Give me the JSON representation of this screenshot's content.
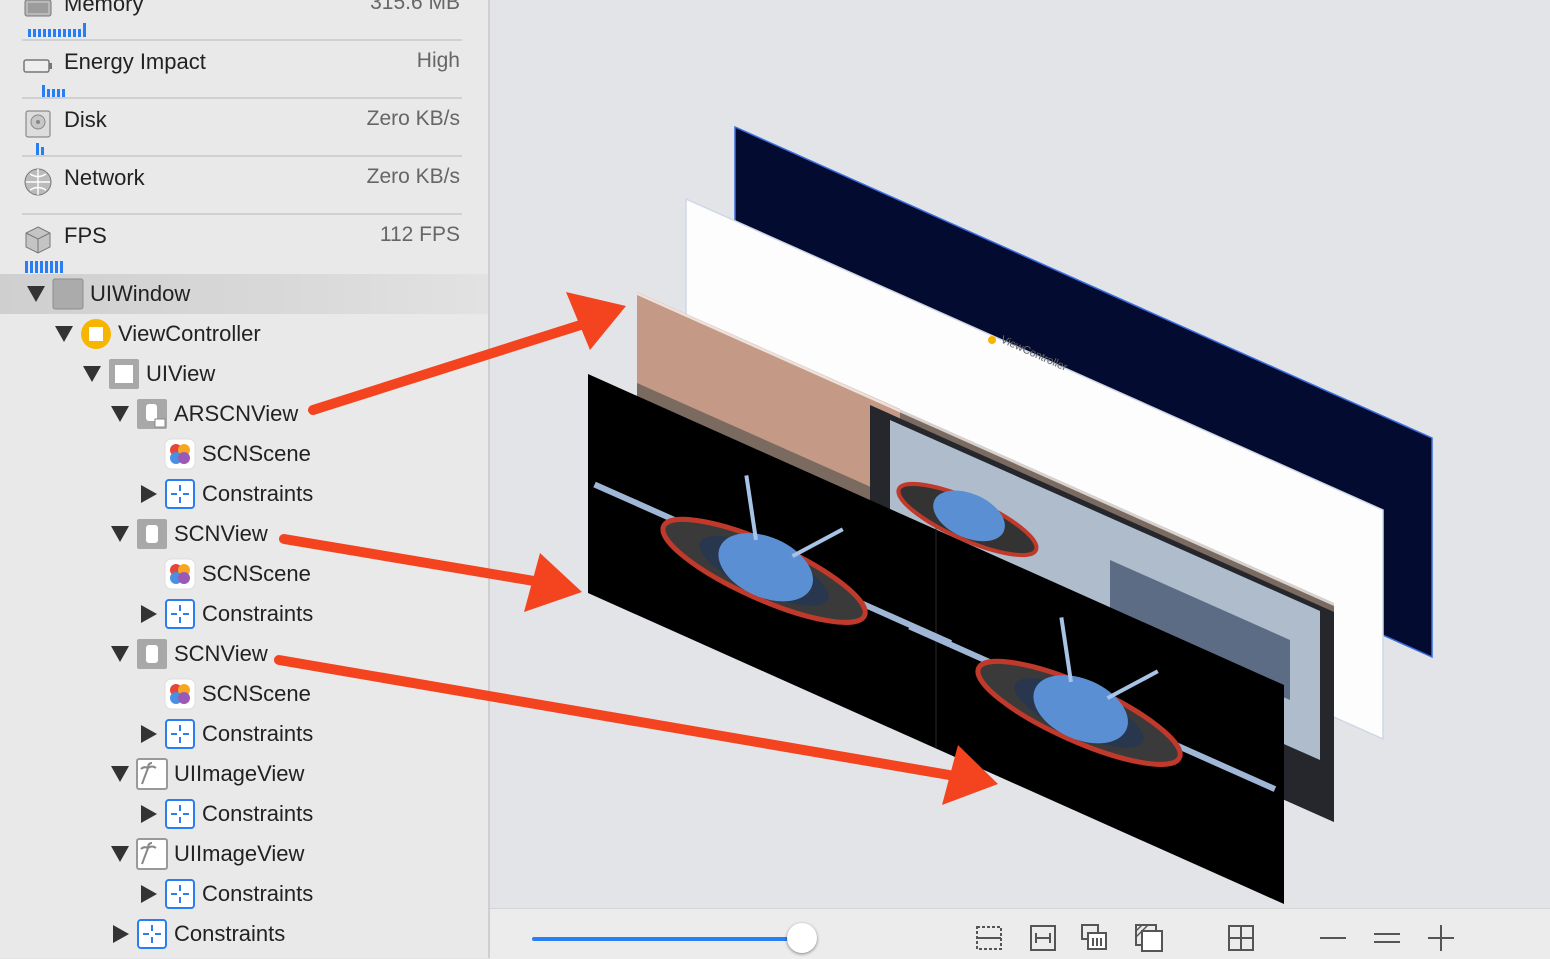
{
  "gauges": [
    {
      "label": "Memory",
      "value": "315.6 MB",
      "icon": "memory-chip-icon"
    },
    {
      "label": "Energy Impact",
      "value": "High",
      "icon": "battery-icon"
    },
    {
      "label": "Disk",
      "value": "Zero KB/s",
      "icon": "disk-icon"
    },
    {
      "label": "Network",
      "value": "Zero KB/s",
      "icon": "globe-icon"
    },
    {
      "label": "FPS",
      "value": "112 FPS",
      "icon": "cube-icon"
    }
  ],
  "tree": [
    {
      "label": "UIWindow",
      "icon": "window-icon",
      "expanded": true,
      "selected": true
    },
    {
      "label": "ViewController",
      "icon": "view-controller-icon",
      "expanded": true
    },
    {
      "label": "UIView",
      "icon": "view-icon",
      "expanded": true
    },
    {
      "label": "ARSCNView",
      "icon": "arscnview-icon",
      "expanded": true
    },
    {
      "label": "SCNScene",
      "icon": "scnscene-icon"
    },
    {
      "label": "Constraints",
      "icon": "constraints-icon",
      "expanded": false
    },
    {
      "label": "SCNView",
      "icon": "scnview-icon",
      "expanded": true
    },
    {
      "label": "SCNScene",
      "icon": "scnscene-icon"
    },
    {
      "label": "Constraints",
      "icon": "constraints-icon",
      "expanded": false
    },
    {
      "label": "SCNView",
      "icon": "scnview-icon",
      "expanded": true
    },
    {
      "label": "SCNScene",
      "icon": "scnscene-icon"
    },
    {
      "label": "Constraints",
      "icon": "constraints-icon",
      "expanded": false
    },
    {
      "label": "UIImageView",
      "icon": "image-view-icon",
      "expanded": true
    },
    {
      "label": "Constraints",
      "icon": "constraints-icon",
      "expanded": false
    },
    {
      "label": "UIImageView",
      "icon": "image-view-icon",
      "expanded": true
    },
    {
      "label": "Constraints",
      "icon": "constraints-icon",
      "expanded": false
    },
    {
      "label": "Constraints",
      "icon": "constraints-icon",
      "expanded": false
    }
  ],
  "canvas": {
    "layer_caption": "ViewController",
    "accent": "#2a7ef4",
    "arrow_color": "#f4431f",
    "back_panel_color": "#030c30"
  },
  "toolbar": {
    "zoom_slider_value": 0.93,
    "icons": [
      "clip-content-icon",
      "show-constraints-icon",
      "layer-spacing-icon",
      "wireframe-icon",
      "grid-icon",
      "zoom-out-icon",
      "actual-size-icon",
      "zoom-in-icon"
    ]
  }
}
